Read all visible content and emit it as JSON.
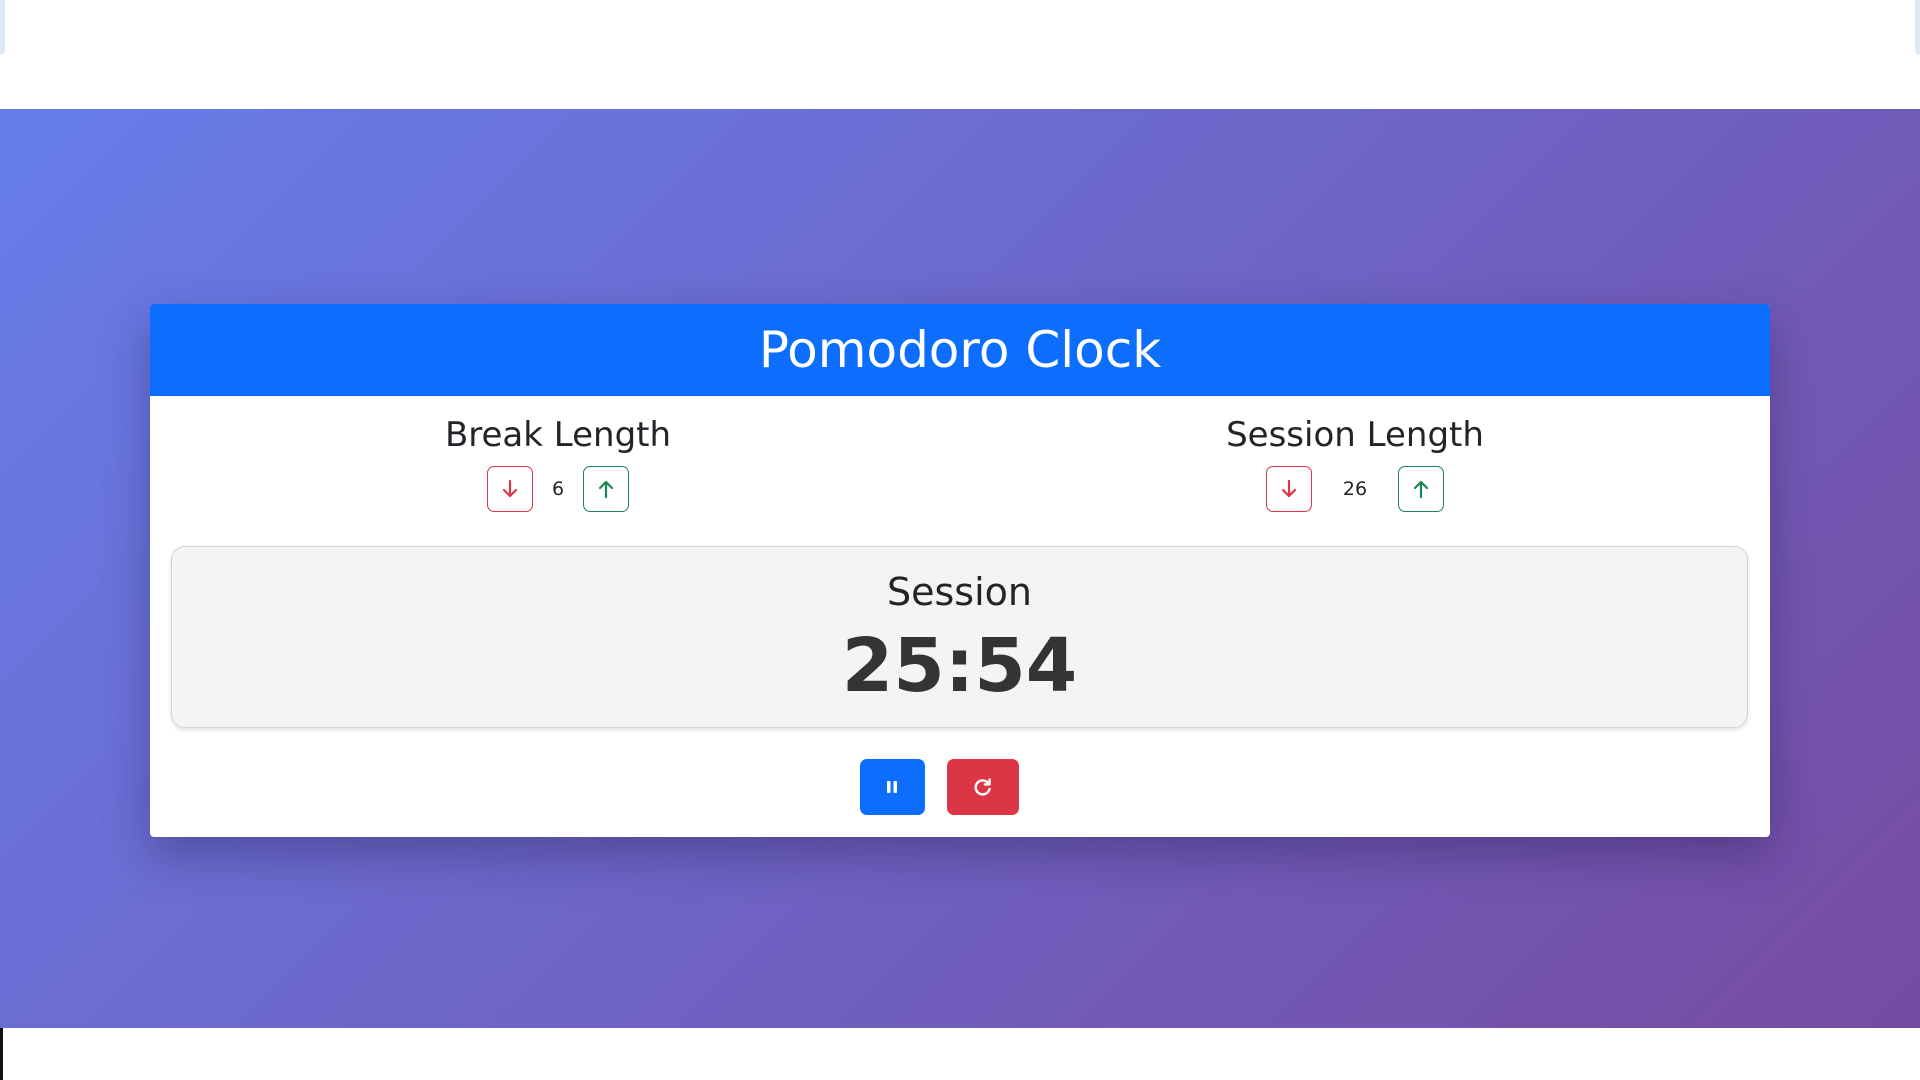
{
  "app": {
    "title": "Pomodoro Clock"
  },
  "break": {
    "label": "Break Length",
    "value": "6",
    "decrement_icon": "arrow-down-icon",
    "increment_icon": "arrow-up-icon"
  },
  "session": {
    "label": "Session Length",
    "value": "26",
    "decrement_icon": "arrow-down-icon",
    "increment_icon": "arrow-up-icon"
  },
  "timer": {
    "label": "Session",
    "time": "25:54"
  },
  "actions": {
    "pause_icon": "pause-icon",
    "reset_icon": "refresh-icon"
  },
  "colors": {
    "primary": "#0d6efd",
    "danger": "#dc3545",
    "success": "#198754",
    "gradient_start": "#667eea",
    "gradient_end": "#764ba2"
  }
}
